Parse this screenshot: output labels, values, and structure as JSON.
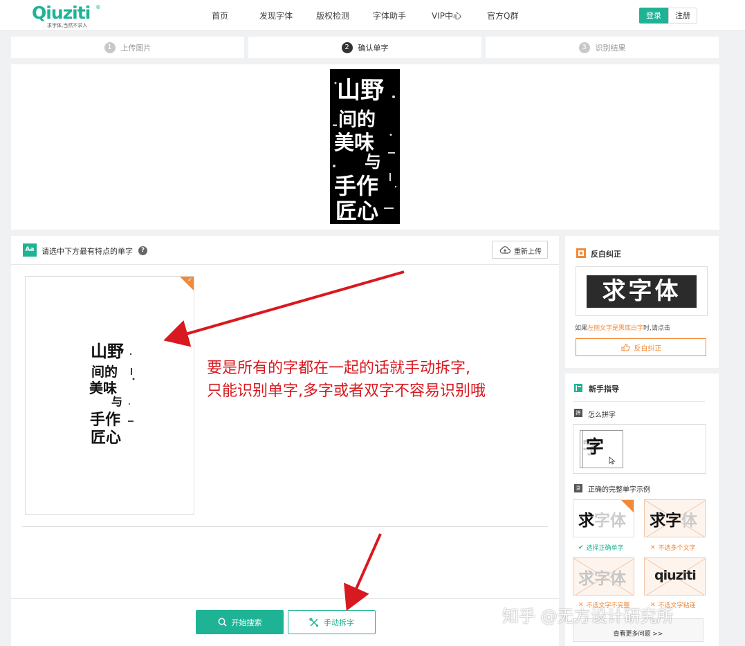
{
  "header": {
    "logo_text": "Qiuziti",
    "logo_reg": "®",
    "logo_slogan": "求字体,当然不求人",
    "nav": [
      "首页",
      "发现字体",
      "版权检测",
      "字体助手",
      "VIP中心",
      "官方Q群"
    ],
    "login_label": "登录",
    "register_label": "注册"
  },
  "steps": [
    {
      "num": "1",
      "label": "上传图片"
    },
    {
      "num": "2",
      "label": "确认单字"
    },
    {
      "num": "3",
      "label": "识别结果"
    }
  ],
  "preview": {
    "art_lines": [
      "山野",
      "间的",
      "美味",
      "与",
      "手作",
      "匠心"
    ]
  },
  "panel": {
    "title": "请选中下方最有特点的单字",
    "aa_icon_text": "Aa",
    "help_icon_text": "?",
    "reupload_label": "重新上传",
    "annotation_line1": "要是所有的字都在一起的话就手动拆字,",
    "annotation_line2": "只能识别单字,多字或者双字不容易识别哦",
    "search_label": "开始搜索",
    "split_label": "手动拆字"
  },
  "sidebar": {
    "invert_title": "反白纠正",
    "invert_sample": "求字体",
    "invert_hint_pre": "如果",
    "invert_hint_hl": "左侧文字是黑底白字",
    "invert_hint_post": "时,请点击",
    "invert_button": "反白纠正",
    "guide_title": "新手指导",
    "how_split_title": "怎么拼字",
    "how_split_char": "字",
    "examples_title": "正确的完整单字示例",
    "sample1_dark": "求",
    "sample1_light": "字体",
    "sample1_caption": "选择正确单字",
    "sample2_dark": "求字",
    "sample2_light": "体",
    "sample2_caption": "不选多个文字",
    "sample3_text": "求字体",
    "sample3_caption": "不选文字不完整",
    "sample4_text": "qiuziti",
    "sample4_caption": "不选文字粘连",
    "more_label": "查看更多问题 >>"
  },
  "watermark": "知乎 @无方设计研究所",
  "colors": {
    "brand": "#1fb395",
    "accent": "#f08a3a",
    "annotation": "#d8191f"
  }
}
